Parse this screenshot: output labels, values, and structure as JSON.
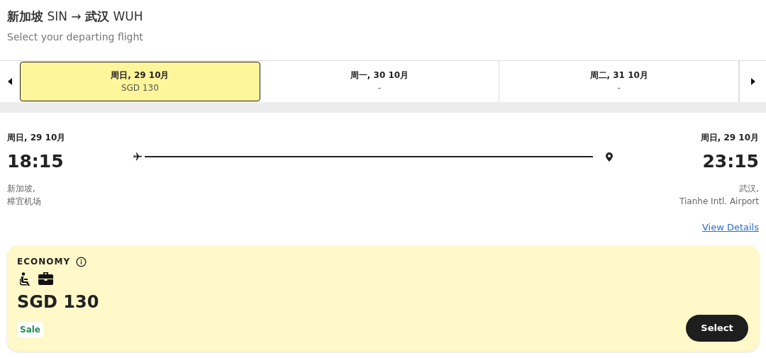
{
  "header": {
    "route": "**新加坡** SIN → **武汉** WUH",
    "subtitle": "Select your departing flight"
  },
  "date_tabs": [
    {
      "label": "周日, 29 10月",
      "price": "SGD 130",
      "selected": true
    },
    {
      "label": "周一, 30 10月",
      "price": "-",
      "selected": false
    },
    {
      "label": "周二, 31 10月",
      "price": "-",
      "selected": false
    }
  ],
  "flight": {
    "departure": {
      "date": "周日, 29 10月",
      "time": "18:15",
      "city": "新加坡,",
      "airport": "樟宜机场"
    },
    "arrival": {
      "date": "周日, 29 10月",
      "time": "23:15",
      "city": "武汉,",
      "airport": "Tianhe Intl. Airport"
    },
    "details_link": "View Details"
  },
  "fare": {
    "cabin": "ECONOMY",
    "price": "SGD 130",
    "tag": "Sale",
    "button": "Select"
  }
}
